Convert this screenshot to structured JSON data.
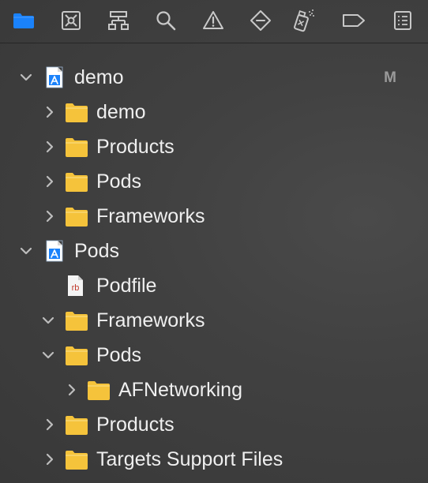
{
  "toolbar": {
    "buttons": [
      {
        "icon": "folder-icon",
        "active": true
      },
      {
        "icon": "source-control-icon",
        "active": false
      },
      {
        "icon": "hierarchy-icon",
        "active": false
      },
      {
        "icon": "search-icon",
        "active": false
      },
      {
        "icon": "warning-icon",
        "active": false
      },
      {
        "icon": "test-diamond-icon",
        "active": false
      },
      {
        "icon": "debug-spray-icon",
        "active": false
      },
      {
        "icon": "breakpoint-tag-icon",
        "active": false
      },
      {
        "icon": "report-list-icon",
        "active": false
      }
    ]
  },
  "navigator": {
    "items": [
      {
        "label": "demo",
        "level": 0,
        "expanded": true,
        "icon": "project-icon",
        "badge": "M"
      },
      {
        "label": "demo",
        "level": 1,
        "expanded": false,
        "icon": "folder-icon"
      },
      {
        "label": "Products",
        "level": 1,
        "expanded": false,
        "icon": "folder-icon"
      },
      {
        "label": "Pods",
        "level": 1,
        "expanded": false,
        "icon": "folder-icon"
      },
      {
        "label": "Frameworks",
        "level": 1,
        "expanded": false,
        "icon": "folder-icon"
      },
      {
        "label": "Pods",
        "level": 0,
        "expanded": true,
        "icon": "project-icon"
      },
      {
        "label": "Podfile",
        "level": 1,
        "expanded": null,
        "icon": "ruby-file-icon",
        "file_tag": "rb"
      },
      {
        "label": "Frameworks",
        "level": 1,
        "expanded": true,
        "icon": "folder-icon"
      },
      {
        "label": "Pods",
        "level": 1,
        "expanded": true,
        "icon": "folder-icon"
      },
      {
        "label": "AFNetworking",
        "level": 2,
        "expanded": false,
        "icon": "folder-icon"
      },
      {
        "label": "Products",
        "level": 1,
        "expanded": false,
        "icon": "folder-icon"
      },
      {
        "label": "Targets Support Files",
        "level": 1,
        "expanded": false,
        "icon": "folder-icon"
      }
    ]
  },
  "colors": {
    "accent": "#1a82fb",
    "folder": "#f5c33b",
    "icon_gray": "#c8c8c8",
    "chevron": "#bdbdbd",
    "label": "#efefef",
    "badge": "#9a9a9a",
    "ruby_red": "#c0392b"
  }
}
